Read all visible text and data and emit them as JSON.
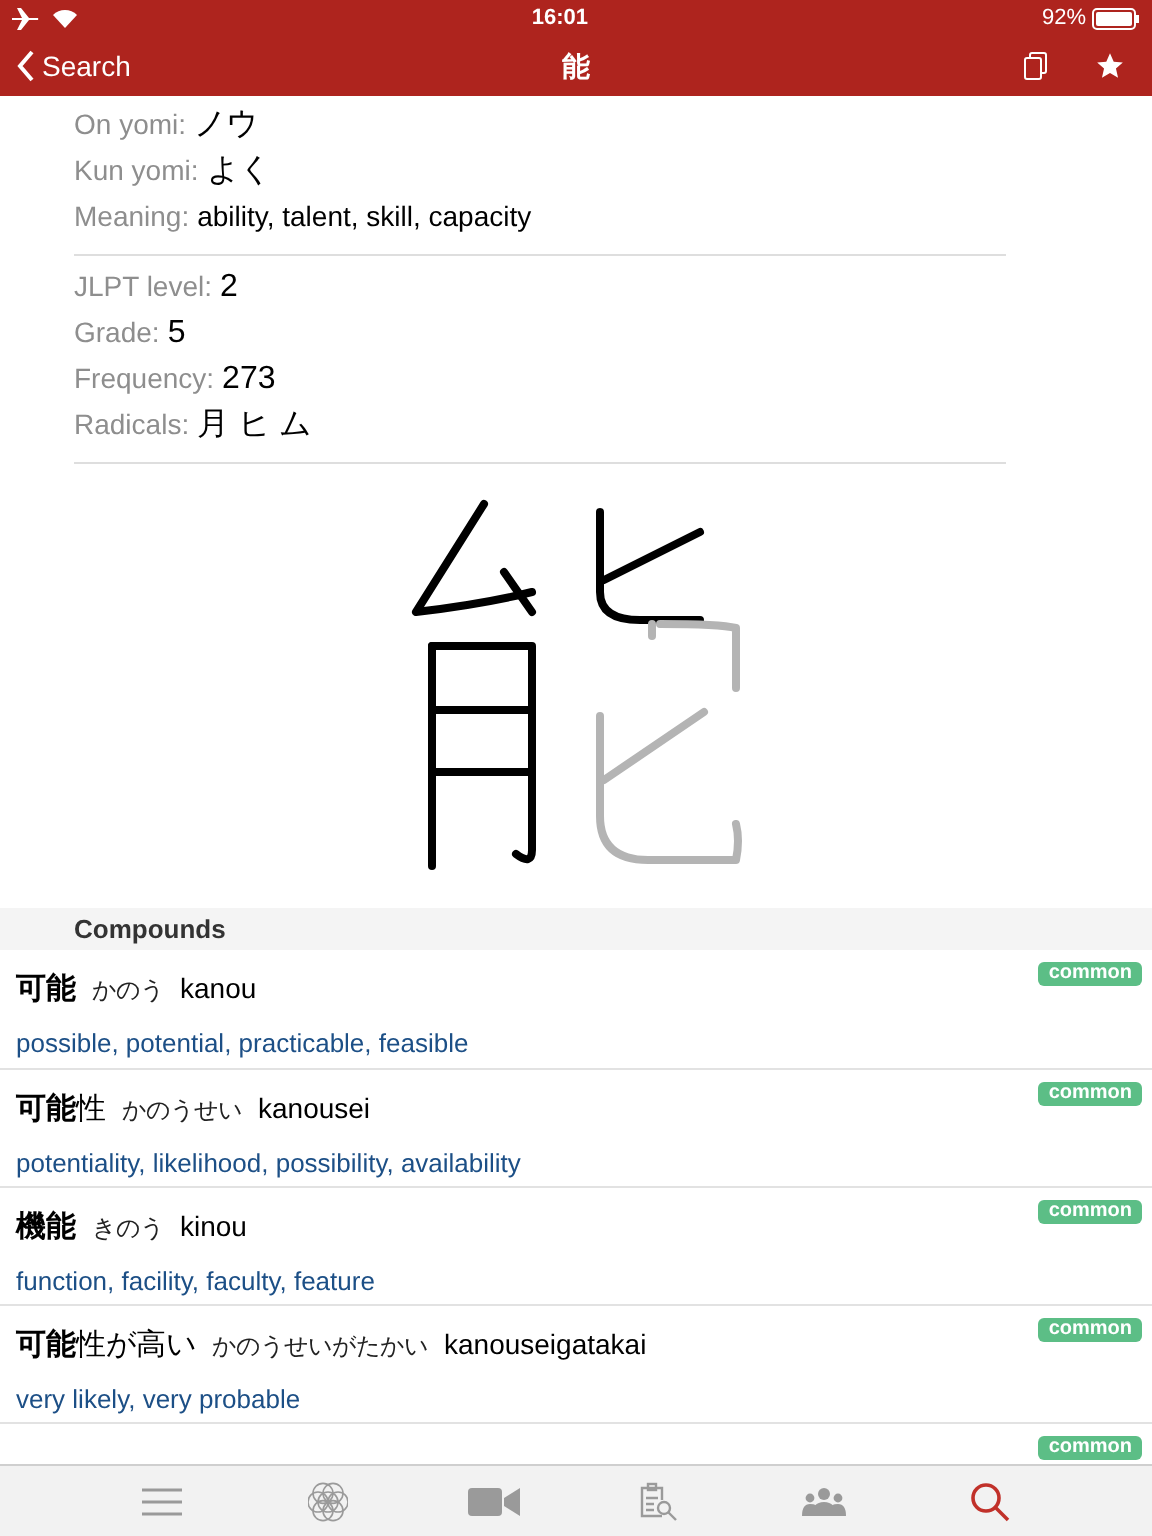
{
  "status_bar": {
    "time": "16:01",
    "battery": "92%"
  },
  "nav": {
    "back": "Search",
    "title": "能"
  },
  "info_groups": [
    [
      {
        "label": "On yomi:",
        "value": "ノウ"
      },
      {
        "label": "Kun yomi:",
        "value": "よく"
      },
      {
        "label": "Meaning:",
        "value": "ability, talent, skill, capacity"
      }
    ],
    [
      {
        "label": "JLPT level:",
        "value": "2"
      },
      {
        "label": "Grade:",
        "value": "5"
      },
      {
        "label": "Frequency:",
        "value": "273"
      },
      {
        "label": "Radicals:",
        "value": "月 ヒ ム"
      }
    ]
  ],
  "compounds": {
    "title": "Compounds",
    "items": [
      {
        "word": "**可能**",
        "reading": "かのう",
        "romaji": "kanou",
        "meaning": "possible, potential, practicable, feasible",
        "tag": "common"
      },
      {
        "word": "**可能**性",
        "reading": "かのうせい",
        "romaji": "kanousei",
        "meaning": "potentiality, likelihood, possibility, availability",
        "tag": "common"
      },
      {
        "word": "**機能**",
        "reading": "きのう",
        "romaji": "kinou",
        "meaning": "function, facility, faculty, feature",
        "tag": "common"
      },
      {
        "word": "**可能**性が高い",
        "reading": "かのうせいがたかい",
        "romaji": "kanouseigatakai",
        "meaning": "very likely, very probable",
        "tag": "common"
      },
      {
        "tag": "common"
      }
    ]
  },
  "tab_bar": [
    {
      "kind": "menu",
      "selected": false
    },
    {
      "kind": "flower",
      "selected": false
    },
    {
      "kind": "video",
      "selected": false
    },
    {
      "kind": "clipboard",
      "selected": false
    },
    {
      "kind": "people",
      "selected": false
    },
    {
      "kind": "search",
      "selected": true
    }
  ]
}
